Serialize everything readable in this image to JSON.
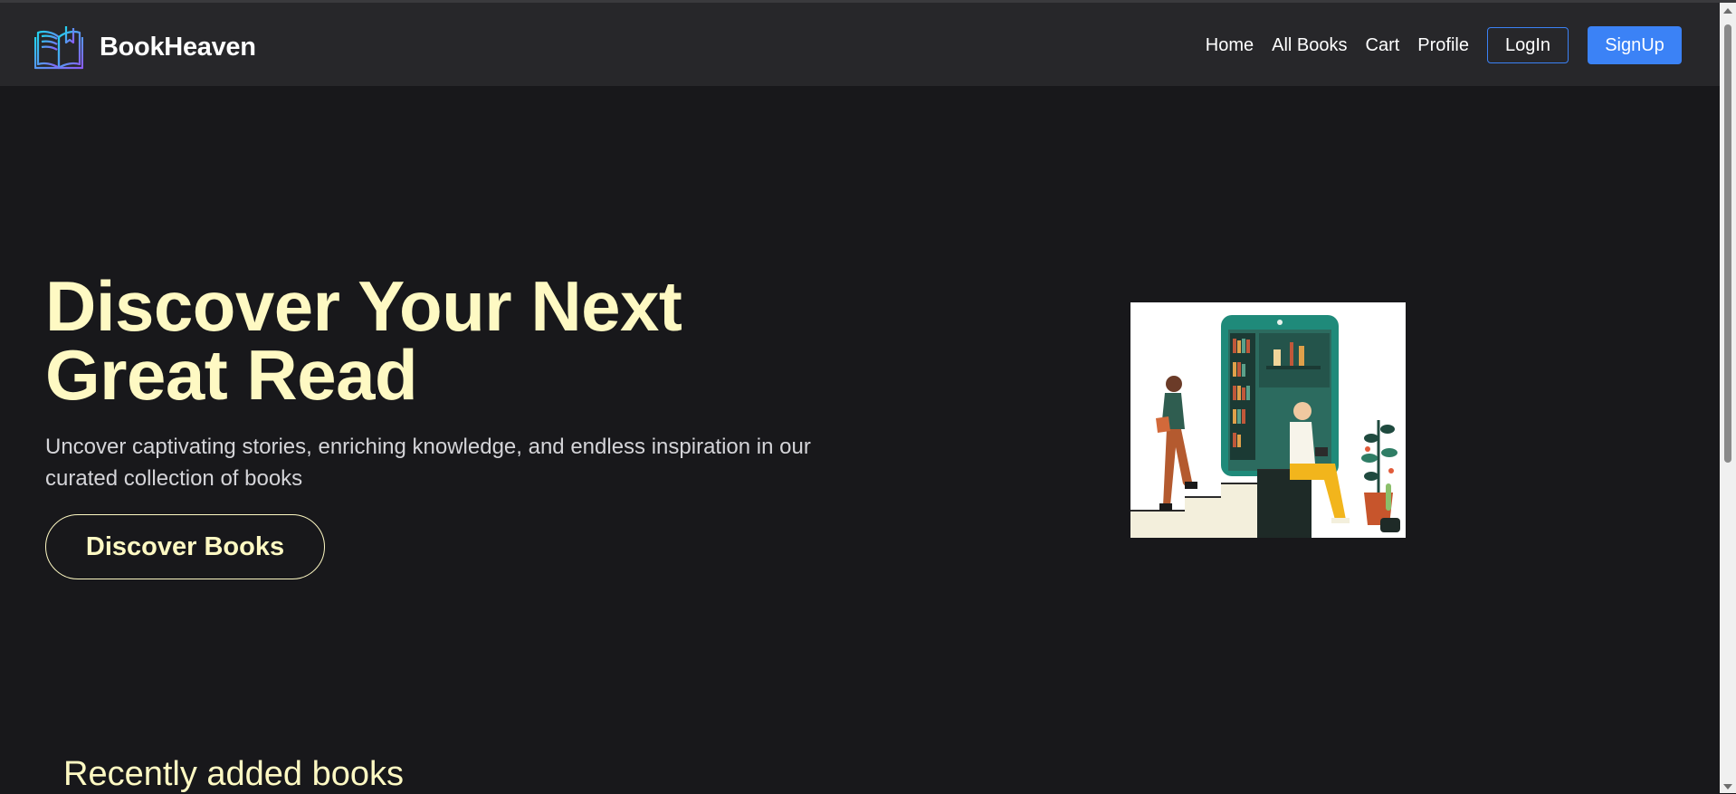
{
  "colors": {
    "page_bg": "#18181b",
    "navbar_bg": "#27272a",
    "accent": "#fef9c3",
    "primary": "#3b82f6"
  },
  "brand": {
    "name": "BookHeaven",
    "logo_icon": "open-book-icon"
  },
  "nav": {
    "links": [
      "Home",
      "All Books",
      "Cart",
      "Profile"
    ],
    "login_label": "LogIn",
    "signup_label": "SignUp"
  },
  "hero": {
    "title": "Discover Your Next Great Read",
    "subtitle": "Uncover captivating stories, enriching knowledge, and endless inspiration in our curated collection of books",
    "cta_label": "Discover Books",
    "image_icon": "reading-illustration"
  },
  "recent": {
    "title": "Recently added books"
  }
}
